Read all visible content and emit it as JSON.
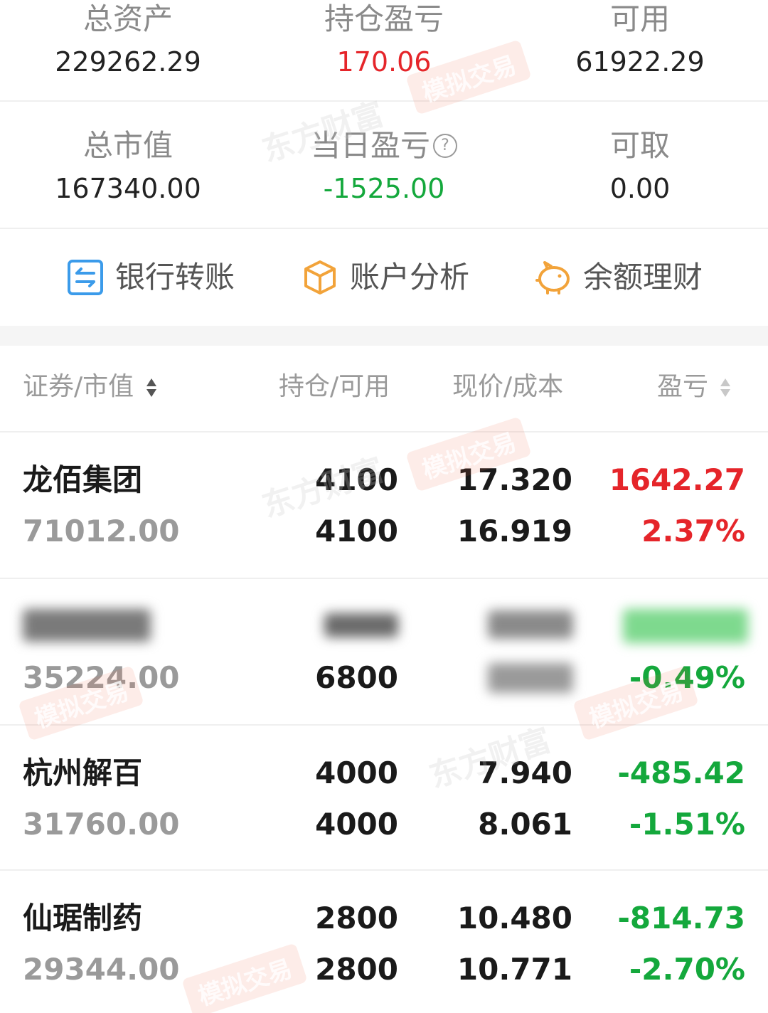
{
  "summary": {
    "row1": [
      {
        "label": "总资产",
        "value": "229262.29",
        "color": "#222222"
      },
      {
        "label": "持仓盈亏",
        "value": "170.06",
        "color": "#e5252a"
      },
      {
        "label": "可用",
        "value": "61922.29",
        "color": "#222222"
      }
    ],
    "row2": [
      {
        "label": "总市值",
        "value": "167340.00",
        "color": "#222222"
      },
      {
        "label": "当日盈亏",
        "value": "-1525.00",
        "color": "#14a83c",
        "help_icon": "?"
      },
      {
        "label": "可取",
        "value": "0.00",
        "color": "#222222"
      }
    ]
  },
  "actions": [
    {
      "label": "银行转账",
      "icon": "transfer-icon",
      "color": "#3b9bea"
    },
    {
      "label": "账户分析",
      "icon": "box-icon",
      "color": "#f2a33a"
    },
    {
      "label": "余额理财",
      "icon": "piggy-bank-icon",
      "color": "#f2a33a"
    }
  ],
  "table": {
    "headers": {
      "security": "证券/市值",
      "position": "持仓/可用",
      "price": "现价/成本",
      "pnl": "盈亏"
    },
    "rows": [
      {
        "name": "龙佰集团",
        "market_value": "71012.00",
        "position": "4100",
        "available": "4100",
        "price": "17.320",
        "cost": "16.919",
        "pnl": "1642.27",
        "pnl_pct": "2.37%",
        "trend": "up"
      },
      {
        "name": "",
        "market_value": "35224.00",
        "position": "",
        "available": "6800",
        "price": "",
        "cost": "",
        "pnl": "",
        "pnl_pct": "-0.49%",
        "trend": "down",
        "obscured": true
      },
      {
        "name": "杭州解百",
        "market_value": "31760.00",
        "position": "4000",
        "available": "4000",
        "price": "7.940",
        "cost": "8.061",
        "pnl": "-485.42",
        "pnl_pct": "-1.51%",
        "trend": "down"
      },
      {
        "name": "仙琚制药",
        "market_value": "29344.00",
        "position": "2800",
        "available": "2800",
        "price": "10.480",
        "cost": "10.771",
        "pnl": "-814.73",
        "pnl_pct": "-2.70%",
        "trend": "down"
      }
    ]
  },
  "watermark": {
    "brand": "东方财富",
    "badge": "模拟交易"
  }
}
